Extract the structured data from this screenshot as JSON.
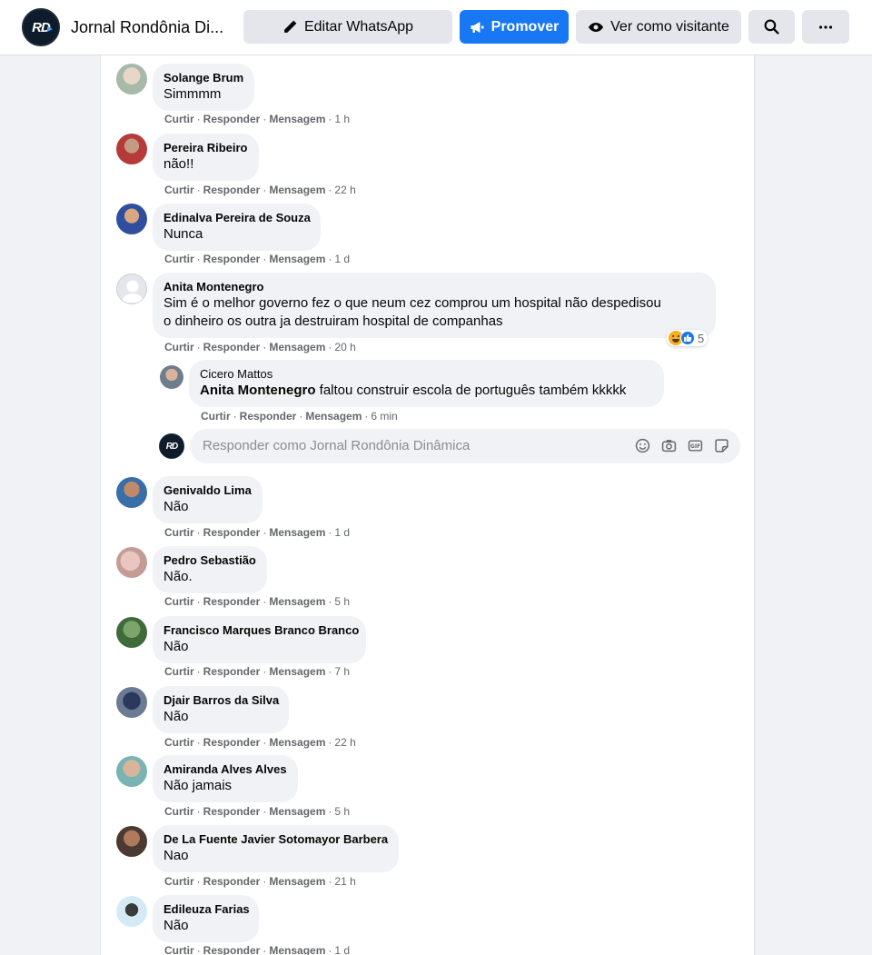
{
  "header": {
    "page_name": "Jornal Rondônia Di...",
    "logo_text": "RD",
    "buttons": {
      "edit_whatsapp": "Editar WhatsApp",
      "promote": "Promover",
      "view_as_visitor": "Ver como visitante"
    }
  },
  "action_labels": {
    "like": "Curtir",
    "reply": "Responder",
    "message": "Mensagem"
  },
  "comments": [
    {
      "author": "Solange Brum",
      "text": "Simmmm",
      "time": "1 h"
    },
    {
      "author": "Pereira Ribeiro",
      "text": "não!!",
      "time": "22 h"
    },
    {
      "author": "Edinalva Pereira de Souza",
      "text": "Nunca",
      "time": "1 d"
    },
    {
      "author": "Anita Montenegro",
      "text_line1": "Sim é o melhor governo fez o que neum cez comprou um hospital não despedisou",
      "text_line2": "o dinheiro os outra ja destruiram hospital de companhas",
      "time": "20 h",
      "reaction_count": "5"
    },
    {
      "author": "Genivaldo Lima",
      "text": "Não",
      "time": "1 d"
    },
    {
      "author": "Pedro Sebastião",
      "text": "Não.",
      "time": "5 h"
    },
    {
      "author": "Francisco Marques Branco Branco",
      "text": "Não",
      "time": "7 h"
    },
    {
      "author": "Djair Barros da Silva",
      "text": "Não",
      "time": "22 h"
    },
    {
      "author": "Amiranda Alves Alves",
      "text": "Não jamais",
      "time": "5 h"
    },
    {
      "author": "De La Fuente Javier Sotomayor Barbera",
      "text": "Nao",
      "time": "21 h"
    },
    {
      "author": "Edileuza Farias",
      "text": "Não",
      "time": "1 d"
    }
  ],
  "reply": {
    "author": "Cicero Mattos",
    "mention": "Anita Montenegro",
    "text": " faltou construir escola de português também kkkkk",
    "time": "6 min"
  },
  "reply_input": {
    "placeholder": "Responder como Jornal Rondônia Dinâmica"
  },
  "colors": {
    "primary": "#1877f2",
    "bubble": "#f0f2f5",
    "secondary_text": "#65676b"
  }
}
